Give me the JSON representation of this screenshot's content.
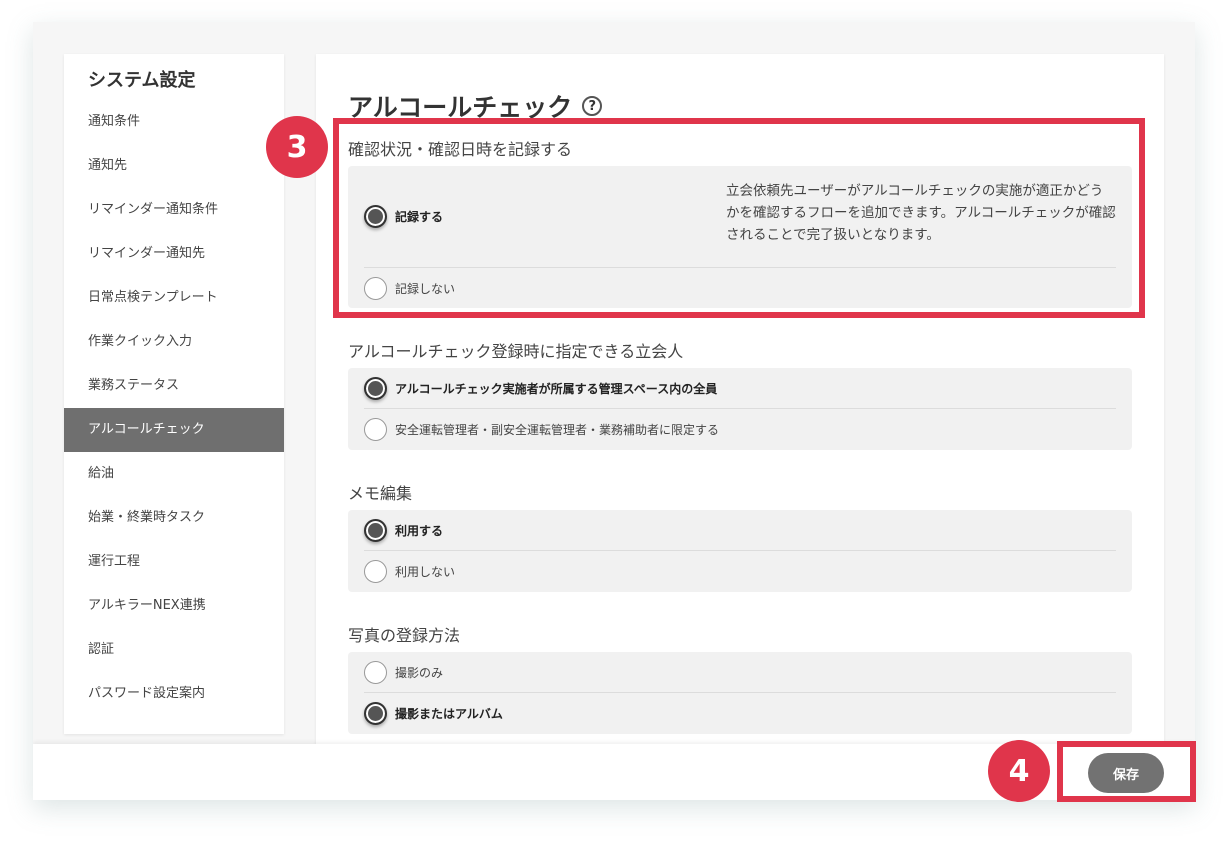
{
  "sidebar": {
    "title": "システム設定",
    "items": [
      "通知条件",
      "通知先",
      "リマインダー通知条件",
      "リマインダー通知先",
      "日常点検テンプレート",
      "作業クイック入力",
      "業務ステータス",
      "アルコールチェック",
      "給油",
      "始業・終業時タスク",
      "運行工程",
      "アルキラーNEX連携",
      "認証",
      "パスワード設定案内"
    ],
    "active_index": 7
  },
  "main": {
    "title": "アルコールチェック",
    "help_icon": "?",
    "sections": [
      {
        "title": "確認状況・確認日時を記録する",
        "options": [
          "記録する",
          "記録しない"
        ],
        "selected": 0,
        "description": "立会依頼先ユーザーがアルコールチェックの実施が適正かどうかを確認するフローを追加できます。アルコールチェックが確認されることで完了扱いとなります。"
      },
      {
        "title": "アルコールチェック登録時に指定できる立会人",
        "options": [
          "アルコールチェック実施者が所属する管理スペース内の全員",
          "安全運転管理者・副安全運転管理者・業務補助者に限定する"
        ],
        "selected": 0
      },
      {
        "title": "メモ編集",
        "options": [
          "利用する",
          "利用しない"
        ],
        "selected": 0
      },
      {
        "title": "写真の登録方法",
        "options": [
          "撮影のみ",
          "撮影またはアルバム"
        ],
        "selected": 1
      }
    ]
  },
  "footer": {
    "save_label": "保存"
  },
  "annotations": {
    "step3": "3",
    "step4": "4",
    "color": "#e0354b"
  }
}
